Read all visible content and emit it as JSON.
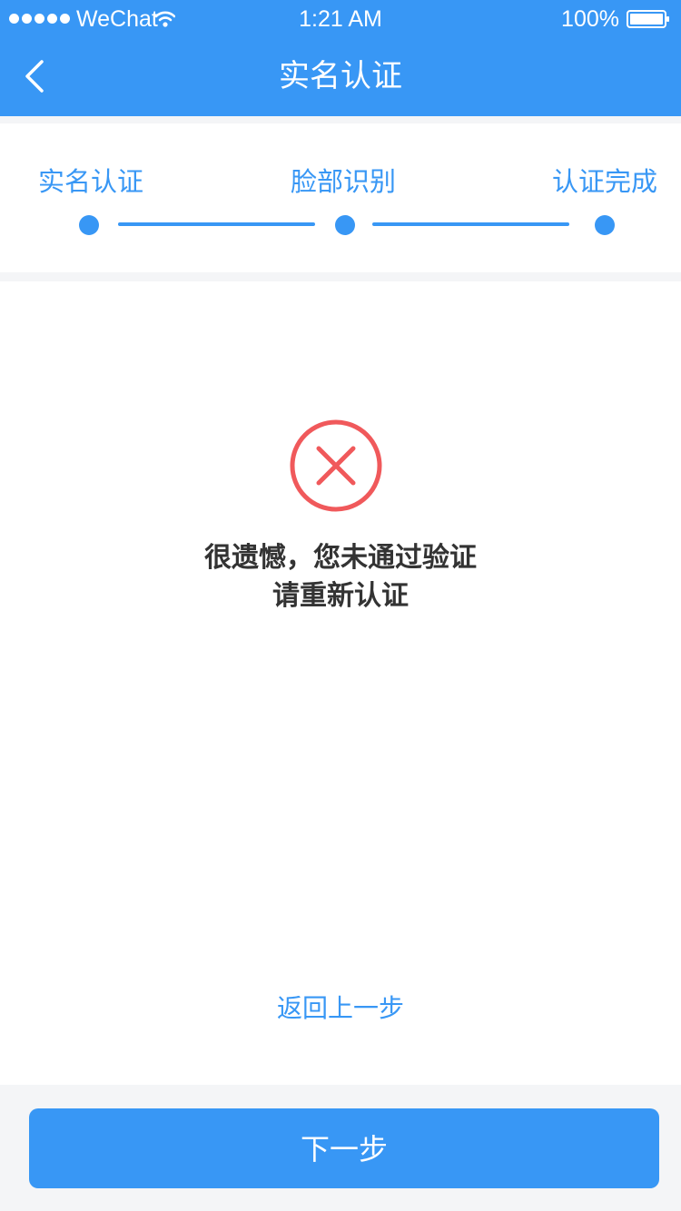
{
  "status_bar": {
    "carrier": "WeChat",
    "time": "1:21 AM",
    "battery_percent": "100%",
    "signal_icon": "signal-dots-icon",
    "wifi_icon": "wifi-icon",
    "battery_icon": "battery-full-icon"
  },
  "nav": {
    "title": "实名认证",
    "back_icon": "chevron-left-icon"
  },
  "steps": [
    {
      "label": "实名认证",
      "status": "done"
    },
    {
      "label": "脸部识别",
      "status": "done"
    },
    {
      "label": "认证完成",
      "status": "done"
    }
  ],
  "result": {
    "icon": "error-circle-icon",
    "line1": "很遗憾，您未通过验证",
    "line2": "请重新认证"
  },
  "actions": {
    "back_link": "返回上一步",
    "next_button": "下一步"
  },
  "colors": {
    "primary": "#3897f5",
    "error": "#f0595b",
    "text": "#333333",
    "background": "#f4f5f7"
  }
}
